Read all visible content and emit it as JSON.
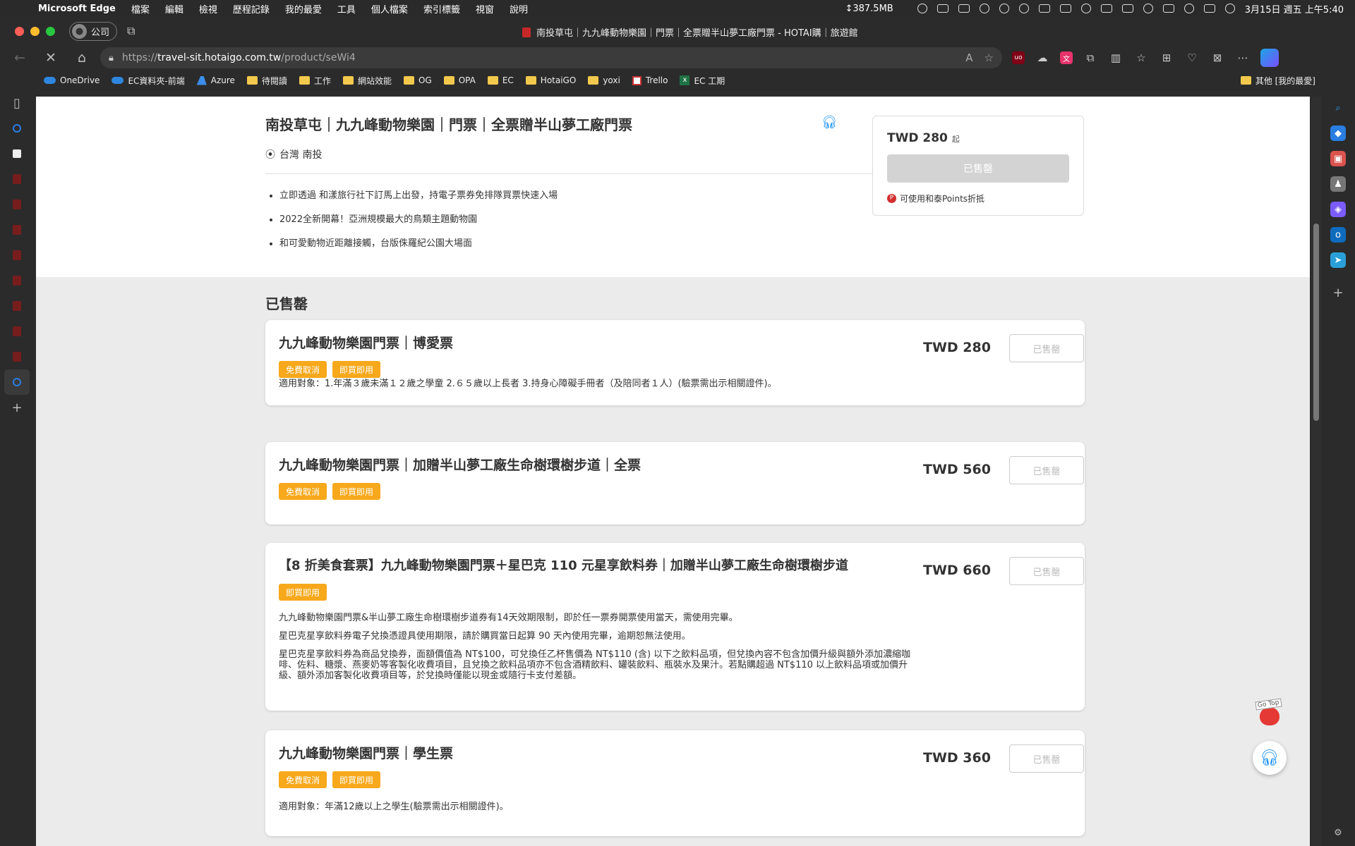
{
  "menubar": {
    "app": "Microsoft Edge",
    "items": [
      "檔案",
      "編輯",
      "檢視",
      "歷程記錄",
      "我的最愛",
      "工具",
      "個人檔案",
      "索引標籤",
      "視窗",
      "說明"
    ],
    "memory": "↕387.5MB",
    "datetime": "3月15日 週五 上午5:40"
  },
  "window": {
    "profile_label": "公司",
    "tab_title": "南投草屯｜九九峰動物樂園｜門票｜全票贈半山夢工廠門票 - HOTAI購｜旅遊館",
    "url_scheme": "https://",
    "url_host": "travel-sit.hotaigo.com.tw",
    "url_path": "/product/seWi4"
  },
  "bookmarks": [
    {
      "label": "OneDrive",
      "icon": "cloud-icon"
    },
    {
      "label": "EC資料夾-前端",
      "icon": "cloud-icon"
    },
    {
      "label": "Azure",
      "icon": "azure-icon"
    },
    {
      "label": "待閱讀",
      "icon": "folder-icon"
    },
    {
      "label": "工作",
      "icon": "folder-icon"
    },
    {
      "label": "網站效能",
      "icon": "folder-icon"
    },
    {
      "label": "OG",
      "icon": "folder-icon"
    },
    {
      "label": "OPA",
      "icon": "folder-icon"
    },
    {
      "label": "EC",
      "icon": "folder-icon"
    },
    {
      "label": "HotaiGO",
      "icon": "folder-icon"
    },
    {
      "label": "yoxi",
      "icon": "folder-icon"
    },
    {
      "label": "Trello",
      "icon": "trello-icon"
    },
    {
      "label": "EC 工期",
      "icon": "excel-icon"
    }
  ],
  "bookmarks_other": "其他 [我的最愛]",
  "product": {
    "title": "南投草屯｜九九峰動物樂園｜門票｜全票贈半山夢工廠門票",
    "location": "台灣 南投",
    "features": [
      "立即透過 和漾旅行社下訂馬上出發，持電子票券免排隊買票快速入場",
      "2022全新開幕！亞洲規模最大的鳥類主題動物園",
      "和可愛動物近距離接觸，台版侏羅紀公園大場面"
    ],
    "price": "TWD 280",
    "price_suffix": "起",
    "sold_out": "已售罄",
    "points_note": "可使用和泰Points折抵"
  },
  "section_title": "已售罄",
  "packages": [
    {
      "title": "九九峰動物樂園門票｜博愛票",
      "tags": [
        "免費取消",
        "即買即用"
      ],
      "desc": [
        "適用對象：1.年滿３歲未滿１２歲之學童 2.６５歲以上長者 3.持身心障礙手冊者（及陪同者１人）(驗票需出示相關證件)。"
      ],
      "price": "TWD 280",
      "button": "已售罄"
    },
    {
      "title": "九九峰動物樂園門票｜加贈半山夢工廠生命樹環樹步道｜全票",
      "tags": [
        "免費取消",
        "即買即用"
      ],
      "desc": [],
      "price": "TWD 560",
      "button": "已售罄"
    },
    {
      "title": "【8 折美食套票】九九峰動物樂園門票＋星巴克 110 元星享飲料券｜加贈半山夢工廠生命樹環樹步道",
      "tags": [
        "即買即用"
      ],
      "desc": [
        "九九峰動物樂園門票&半山夢工廠生命樹環樹步道券有14天效期限制，即於任一票券開票使用當天，需使用完畢。",
        "星巴克星享飲料券電子兌換憑證具使用期限，請於購買當日起算 90 天內使用完畢，逾期恕無法使用。",
        "星巴克星享飲料券為商品兌換券，面額價值為 NT$100，可兌換任乙杯售價為 NT$110 (含) 以下之飲料品項，但兌換內容不包含加價升級與額外添加濃縮咖啡、佐料、糖漿、燕麥奶等客製化收費項目，且兌換之飲料品項亦不包含酒精飲料、罐裝飲料、瓶裝水及果汁。若點購超過 NT$110 以上飲料品項或加價升級、額外添加客製化收費項目等，於兌換時僅能以現金或隨行卡支付差額。"
      ],
      "price": "TWD 660",
      "button": "已售罄"
    },
    {
      "title": "九九峰動物樂園門票｜學生票",
      "tags": [
        "免費取消",
        "即買即用"
      ],
      "desc": [
        "適用對象：年滿12歲以上之學生(驗票需出示相關證件)。"
      ],
      "price": "TWD 360",
      "button": "已售罄"
    }
  ],
  "gotop_label": "Go Top",
  "colors": {
    "tag": "#f7a81b",
    "accent_blue": "#2196f3",
    "sold_gray": "#d3d3d3"
  }
}
